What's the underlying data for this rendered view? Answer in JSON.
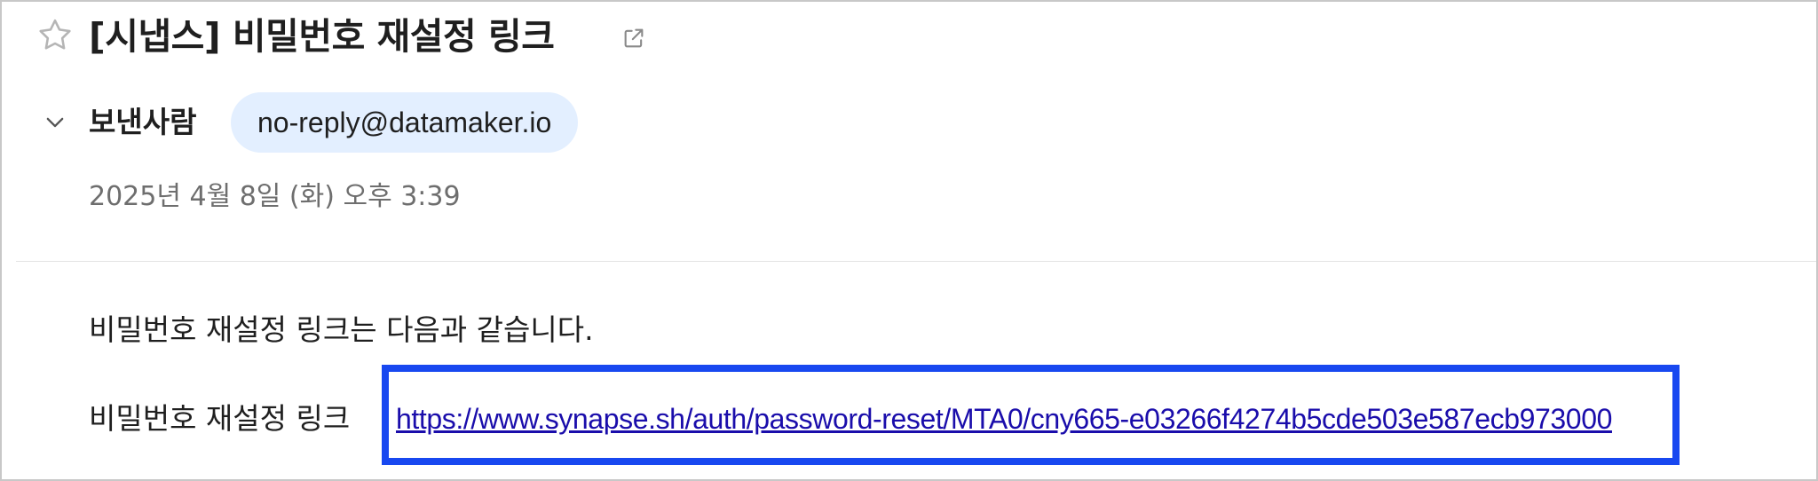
{
  "email": {
    "subject": "[시냅스] 비밀번호 재설정 링크",
    "sender_label": "보낸사람",
    "sender_address": "no-reply@datamaker.io",
    "date": "2025년 4월 8일 (화) 오후 3:39",
    "body": {
      "intro": "비밀번호 재설정 링크는 다음과 같습니다.",
      "link_label": "비밀번호 재설정 링크",
      "link_url": "https://www.synapse.sh/auth/password-reset/MTA0/cny665-e03266f4274b5cde503e587ecb973000"
    }
  },
  "icons": {
    "star": "star-outline-icon",
    "open_external": "open-in-new-window-icon",
    "collapse": "chevron-down-icon"
  },
  "colors": {
    "highlight": "#1848f0",
    "sender_chip_bg": "#e3efff",
    "link": "#1a0dab",
    "muted_text": "#6e6e6e"
  }
}
